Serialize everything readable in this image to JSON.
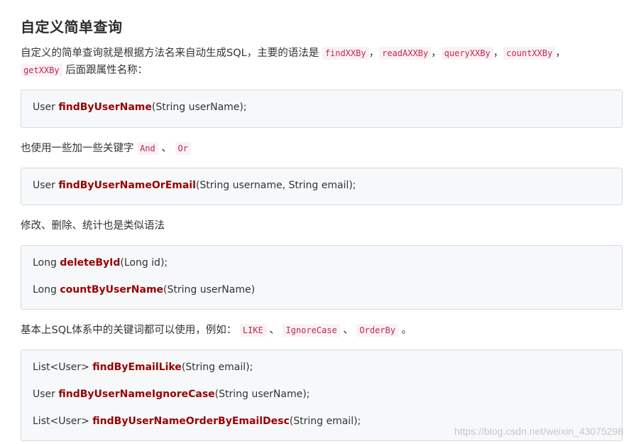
{
  "title": "自定义简单查询",
  "intro": {
    "text1": "自定义的简单查询就是根据方法名来自动生成SQL，主要的语法是",
    "codes": [
      "findXXBy",
      "readAXXBy",
      "queryXXBy",
      "countXXBy",
      "getXXBy"
    ],
    "sep": "，",
    "text2": "后面跟属性名称："
  },
  "block1": [
    {
      "pre": "User  ",
      "fn": "findByUserName",
      "args": "(String  userName);"
    }
  ],
  "para2": {
    "text": "也使用一些加一些关键字",
    "code1": "And",
    "sep": "、",
    "code2": "Or"
  },
  "block2": [
    {
      "pre": "User  ",
      "fn": "findByUserNameOrEmail",
      "args": "(String  username,  String  email);"
    }
  ],
  "para3": {
    "text": "修改、删除、统计也是类似语法"
  },
  "block3": [
    {
      "pre": "Long  ",
      "fn": "deleteById",
      "args": "(Long  id);"
    },
    {
      "pre": "Long  ",
      "fn": "countByUserName",
      "args": "(String  userName)"
    }
  ],
  "para4": {
    "text": "基本上SQL体系中的关键词都可以使用，例如：",
    "code1": "LIKE",
    "code2": "IgnoreCase",
    "code3": "OrderBy",
    "sep": "、",
    "end": "。"
  },
  "block4": [
    {
      "pre": "List<User>  ",
      "fn": "findByEmailLike",
      "args": "(String  email);"
    },
    {
      "pre": "User  ",
      "fn": "findByUserNameIgnoreCase",
      "args": "(String  userName);"
    },
    {
      "pre": "List<User>  ",
      "fn": "findByUserNameOrderByEmailDesc",
      "args": "(String  email);"
    }
  ],
  "watermark": "https://blog.csdn.net/weixin_43075298",
  "colors": {
    "method": "#990000",
    "inline_code": "#c7254e",
    "code_bg": "#f6f8fa"
  }
}
